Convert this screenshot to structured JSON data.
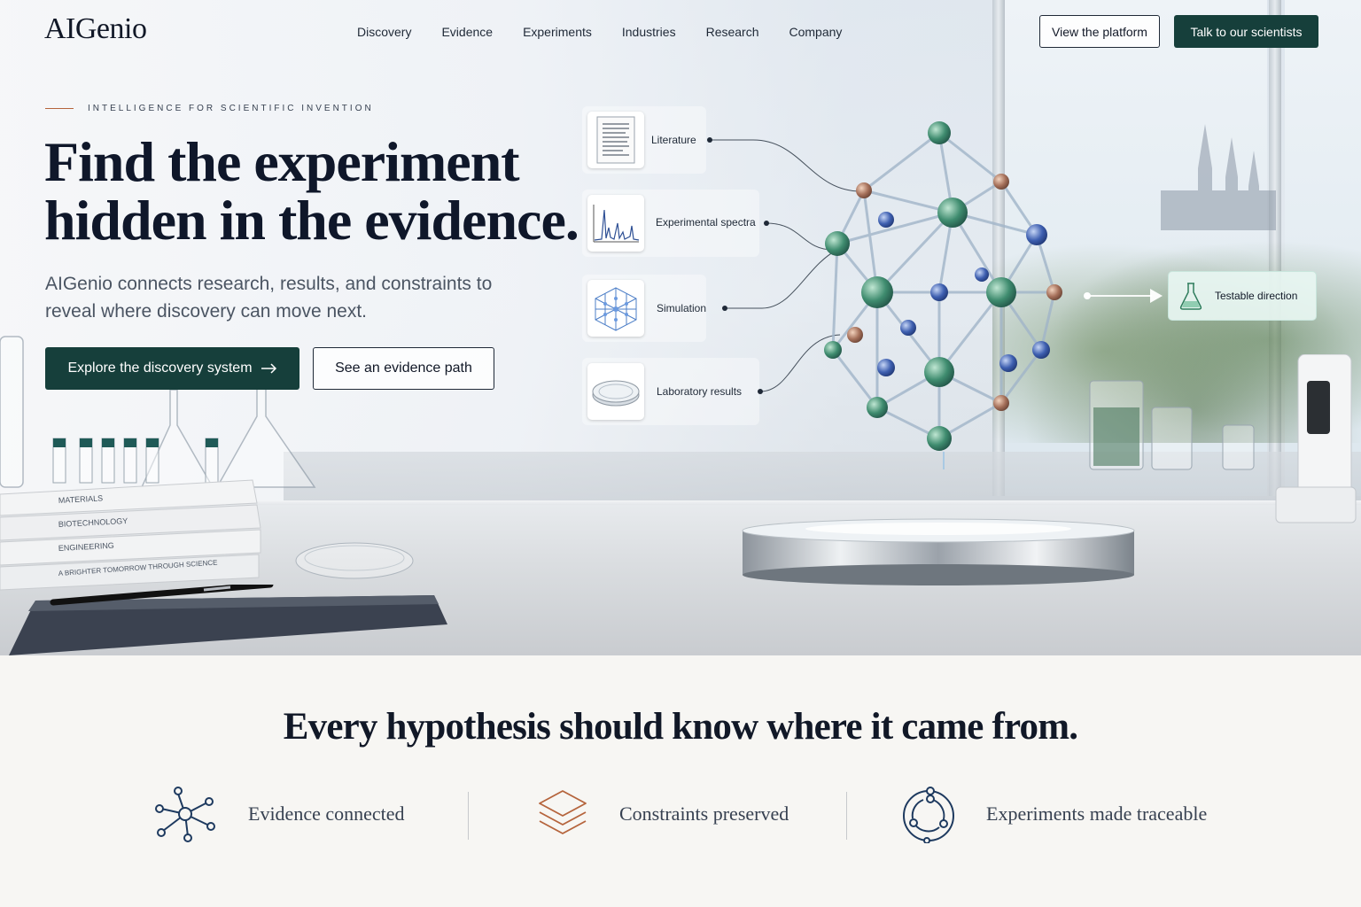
{
  "brand": {
    "name": "AIGenio"
  },
  "nav": {
    "links": [
      "Discovery",
      "Evidence",
      "Experiments",
      "Industries",
      "Research",
      "Company"
    ],
    "view_platform": "View the platform",
    "talk_scientists": "Talk to our scientists"
  },
  "hero": {
    "eyebrow": "INTELLIGENCE FOR SCIENTIFIC INVENTION",
    "headline_line1": "Find the experiment",
    "headline_line2": "hidden in the evidence.",
    "subhead": "AIGenio connects research, results, and constraints to reveal where discovery can move next.",
    "primary_cta": "Explore the discovery system",
    "secondary_cta": "See an evidence path"
  },
  "sources": [
    {
      "label": "Literature",
      "icon": "document-icon"
    },
    {
      "label": "Experimental spectra",
      "icon": "spectrum-chart-icon"
    },
    {
      "label": "Simulation",
      "icon": "lattice-cube-icon"
    },
    {
      "label": "Laboratory results",
      "icon": "petri-dish-icon"
    }
  ],
  "output": {
    "label": "Testable direction",
    "icon": "flask-icon"
  },
  "books": [
    "MATERIALS",
    "BIOTECHNOLOGY",
    "ENGINEERING",
    "A BRIGHTER TOMORROW THROUGH SCIENCE"
  ],
  "lower": {
    "title": "Every hypothesis should know where it came from.",
    "features": [
      {
        "label": "Evidence connected",
        "icon": "network-icon"
      },
      {
        "label": "Constraints preserved",
        "icon": "layers-icon"
      },
      {
        "label": "Experiments made traceable",
        "icon": "cycle-icon"
      }
    ]
  },
  "colors": {
    "brand_dark": "#163f3b",
    "accent_copper": "#b5643c",
    "navy": "#1e3a5f"
  }
}
